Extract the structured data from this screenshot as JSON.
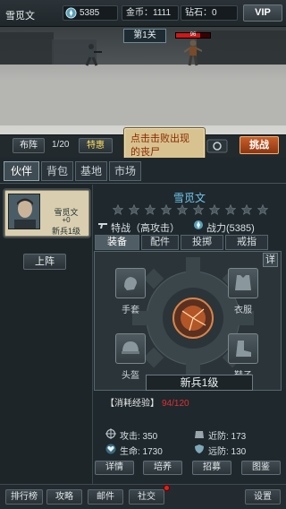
{
  "top_bar": {
    "player_name": "雪觅文",
    "power_value": "5385",
    "gold": "金币：1111",
    "diamond": "钻石：0",
    "vip_label": "VIP"
  },
  "scene": {
    "level_label": "第1关",
    "enemy_hp_text": "96",
    "enemy_hp_fraction": 0.7
  },
  "controls": {
    "formation_label": "布阵",
    "formation_count": "1/20",
    "special_label": "特惠",
    "tooltip_text": "点击击败出现的丧尸",
    "challenge_label": "挑战"
  },
  "tabs": [
    {
      "label": "伙伴",
      "active": true
    },
    {
      "label": "背包",
      "active": false
    },
    {
      "label": "基地",
      "active": false
    },
    {
      "label": "市场",
      "active": false
    }
  ],
  "partner_card": {
    "name": "雪觅文",
    "plus": "+0",
    "rank": "新兵1级",
    "deploy_label": "上阵"
  },
  "hero": {
    "name": "雪觅文",
    "stars_total": 10,
    "stars_filled": 0,
    "specialty": "特战（高攻击）",
    "power": "战力(5385)"
  },
  "sub_tabs": [
    "装备",
    "配件",
    "投掷",
    "戒指"
  ],
  "equipment": {
    "detail_label": "详",
    "slots": {
      "gloves": "手套",
      "clothes": "衣服",
      "helmet": "头盔",
      "shoes": "鞋子"
    },
    "rank_label": "新兵1级",
    "exp_label": "【消耗经验】",
    "exp_value": "94/120"
  },
  "attributes": {
    "attack": "攻击: 350",
    "melee_def": "近防: 173",
    "hp": "生命: 1730",
    "ranged_def": "远防: 130"
  },
  "action_buttons": [
    "详情",
    "培养",
    "招募",
    "图鉴"
  ],
  "bottom_nav": [
    "排行榜",
    "攻略",
    "邮件",
    "社交",
    "设置"
  ],
  "colors": {
    "accent_blue": "#6fc6ea",
    "challenge_orange": "#c8602a",
    "exp_red": "#e03030",
    "tooltip_bg": "#d8c390"
  }
}
